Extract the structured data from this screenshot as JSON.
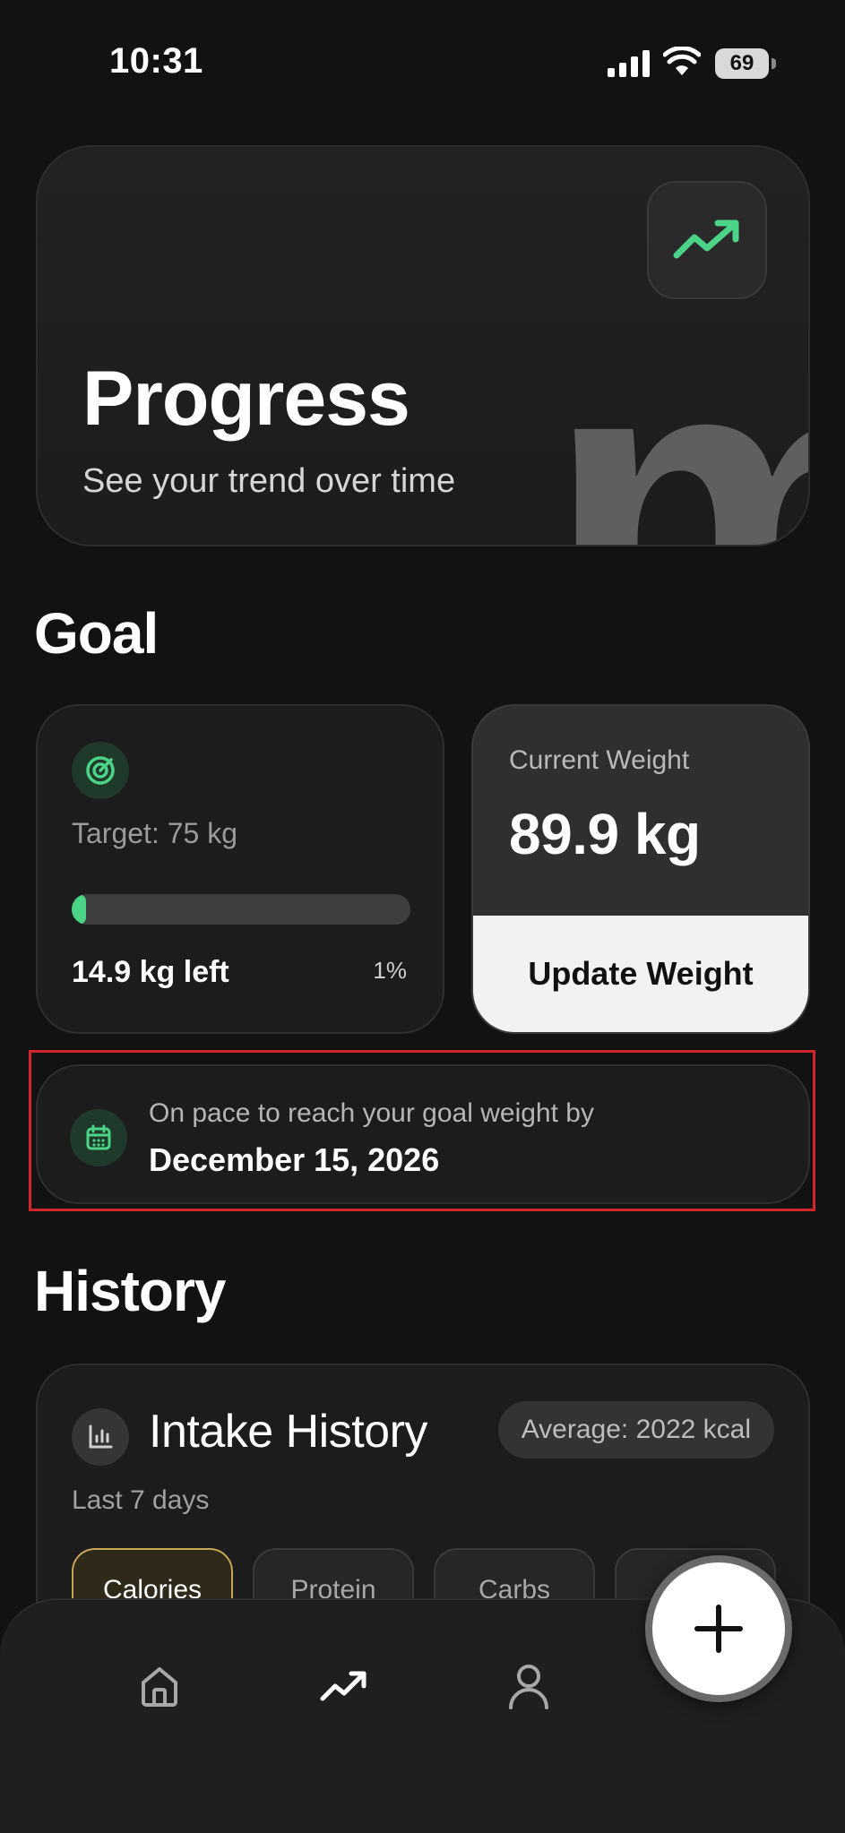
{
  "status_bar": {
    "time": "10:31",
    "battery": "69"
  },
  "hero": {
    "title": "Progress",
    "subtitle": "See your trend over time",
    "bg_letter": "m",
    "icon": "trending-up-icon"
  },
  "goal": {
    "heading": "Goal",
    "target_label": "Target: 75 kg",
    "progress_percent": 1,
    "remaining_label": "14.9 kg left",
    "percent_label": "1%",
    "current_weight_label": "Current Weight",
    "current_weight_value": "89.9 kg",
    "update_button": "Update Weight"
  },
  "pace": {
    "line1": "On pace to reach your goal weight by",
    "date": "December 15, 2026"
  },
  "history": {
    "heading": "History",
    "card_title": "Intake History",
    "average_badge": "Average: 2022 kcal",
    "subtitle": "Last 7 days",
    "tabs": [
      {
        "label": "Calories",
        "active": true
      },
      {
        "label": "Protein",
        "active": false
      },
      {
        "label": "Carbs",
        "active": false
      },
      {
        "label": "",
        "active": false
      }
    ]
  },
  "nav": {
    "items": [
      "home-icon",
      "trending-up-icon",
      "profile-icon"
    ],
    "fab_icon": "plus-icon"
  },
  "colors": {
    "accent_green": "#4bd488",
    "active_chip_border": "#c8a457",
    "highlight_border": "#d0262b"
  }
}
